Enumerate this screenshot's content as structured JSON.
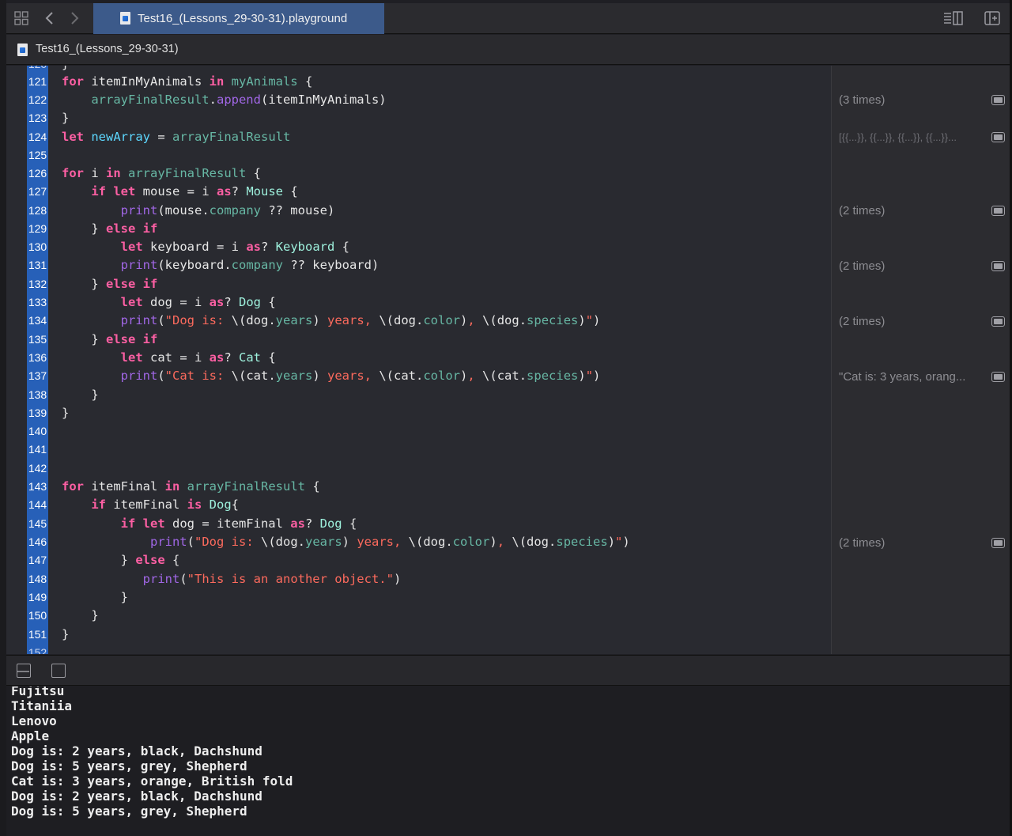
{
  "tabbar": {
    "active_tab": "Test16_(Lessons_29-30-31).playground",
    "icons": [
      "grid-icon",
      "chevron-left-icon",
      "chevron-right-icon",
      "inspector-icon",
      "add-editor-icon"
    ]
  },
  "jumpbar": {
    "file_label": "Test16_(Lessons_29-30-31)"
  },
  "editor": {
    "line_numbers": [
      "121",
      "122",
      "123",
      "124",
      "125",
      "126",
      "127",
      "128",
      "129",
      "130",
      "131",
      "132",
      "133",
      "134",
      "135",
      "136",
      "137",
      "138",
      "139",
      "140",
      "141",
      "142",
      "143",
      "144",
      "145",
      "146",
      "147",
      "148",
      "149",
      "150",
      "151"
    ],
    "results": {
      "r122": "(3 times)",
      "r124": "[{{...}}, {{...}}, {{...}}, {{...}}...",
      "r128": "(2 times)",
      "r131": "(2 times)",
      "r134": "(2 times)",
      "r137": "\"Cat is: 3 years, orang...",
      "r146": "(2 times)"
    }
  },
  "console": {
    "lines": [
      "Fujitsu",
      "Titaniia",
      "Lenovo",
      "Apple",
      "Dog is: 2 years, black, Dachshund",
      "Dog is: 5 years, grey, Shepherd",
      "Cat is: 3 years, orange, British fold",
      "Dog is: 2 years, black, Dachshund",
      "Dog is: 5 years, grey, Shepherd"
    ]
  },
  "colors": {
    "gutter": "#2760b8",
    "keyword": "#fc5fa3",
    "string": "#fc6a5d",
    "type": "#d0a8ff",
    "tab_active": "#3c5a8a"
  }
}
